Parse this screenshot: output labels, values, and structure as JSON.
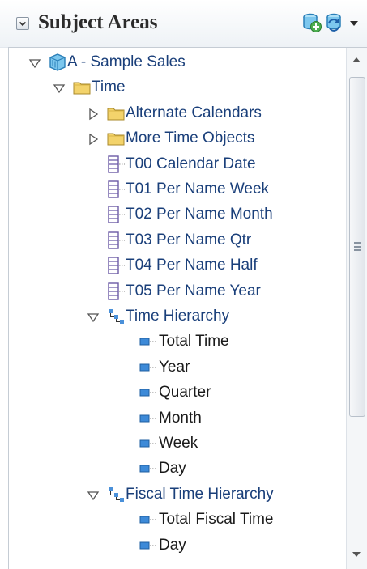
{
  "panel": {
    "title": "Subject Areas",
    "header_icons": [
      "add-subject-area-icon",
      "refresh-icon"
    ]
  },
  "tree": {
    "items": [
      {
        "label": "A - Sample Sales",
        "level": 0,
        "icon": "subject-area-cube-icon",
        "state": "expanded"
      },
      {
        "label": "Time",
        "level": 1,
        "icon": "folder-icon",
        "state": "expanded"
      },
      {
        "label": "Alternate Calendars",
        "level": 2,
        "icon": "folder-icon",
        "state": "collapsed"
      },
      {
        "label": "More Time Objects",
        "level": 2,
        "icon": "folder-icon",
        "state": "collapsed"
      },
      {
        "label": "T00 Calendar Date",
        "level": 2,
        "icon": "column-icon",
        "state": "leaf"
      },
      {
        "label": "T01 Per Name Week",
        "level": 2,
        "icon": "column-icon",
        "state": "leaf"
      },
      {
        "label": "T02 Per Name Month",
        "level": 2,
        "icon": "column-icon",
        "state": "leaf"
      },
      {
        "label": "T03 Per Name Qtr",
        "level": 2,
        "icon": "column-icon",
        "state": "leaf"
      },
      {
        "label": "T04 Per Name Half",
        "level": 2,
        "icon": "column-icon",
        "state": "leaf"
      },
      {
        "label": "T05 Per Name Year",
        "level": 2,
        "icon": "column-icon",
        "state": "leaf"
      },
      {
        "label": "Time Hierarchy",
        "level": 2,
        "icon": "hierarchy-icon",
        "state": "expanded"
      },
      {
        "label": "Total Time",
        "level": 3,
        "icon": "level-icon",
        "state": "leaf"
      },
      {
        "label": "Year",
        "level": 3,
        "icon": "level-icon",
        "state": "leaf"
      },
      {
        "label": "Quarter",
        "level": 3,
        "icon": "level-icon",
        "state": "leaf"
      },
      {
        "label": "Month",
        "level": 3,
        "icon": "level-icon",
        "state": "leaf"
      },
      {
        "label": "Week",
        "level": 3,
        "icon": "level-icon",
        "state": "leaf"
      },
      {
        "label": "Day",
        "level": 3,
        "icon": "level-icon",
        "state": "leaf"
      },
      {
        "label": "Fiscal Time Hierarchy",
        "level": 2,
        "icon": "hierarchy-icon",
        "state": "expanded"
      },
      {
        "label": "Total Fiscal Time",
        "level": 3,
        "icon": "level-icon",
        "state": "leaf"
      },
      {
        "label": "Day",
        "level": 3,
        "icon": "level-icon",
        "state": "leaf"
      }
    ]
  },
  "colors": {
    "link_text": "#1a3f7a",
    "level_text": "#1a1a1a",
    "folder": "#f3d36b",
    "hierarchy": "#4a90d9"
  }
}
